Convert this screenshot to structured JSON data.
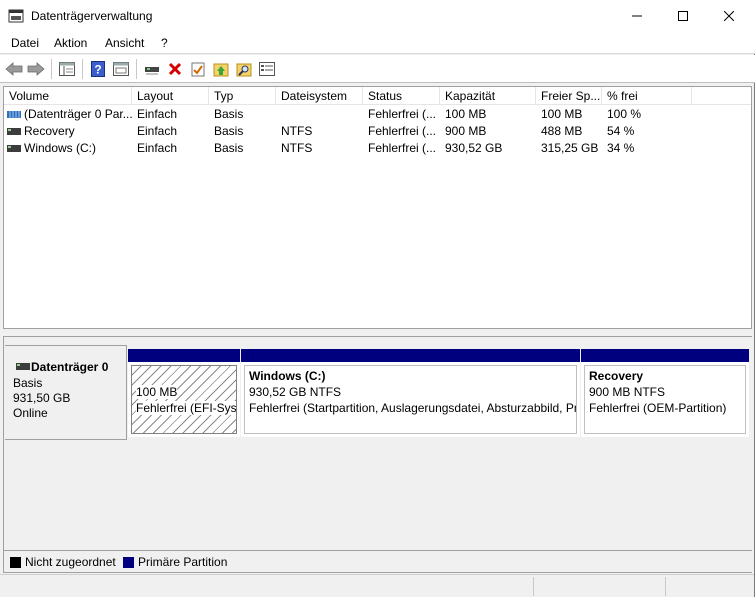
{
  "window": {
    "title": "Datenträgerverwaltung"
  },
  "menu": {
    "items": [
      "Datei",
      "Aktion",
      "Ansicht",
      "?"
    ]
  },
  "toolbar": {
    "icons": [
      "back-arrow-icon",
      "forward-arrow-icon",
      "console-tree-icon",
      "help-icon",
      "properties-view-icon",
      "connect-drive-icon",
      "delete-icon",
      "check-icon",
      "folder-up-icon",
      "folder-search-icon",
      "list-view-icon"
    ]
  },
  "volume_list": {
    "columns": [
      "Volume",
      "Layout",
      "Typ",
      "Dateisystem",
      "Status",
      "Kapazität",
      "Freier Sp...",
      "% frei"
    ],
    "rows": [
      {
        "volume": "(Datenträger 0 Par...",
        "layout": "Einfach",
        "typ": "Basis",
        "dateisystem": "",
        "status": "Fehlerfrei (...",
        "kapazitaet": "100 MB",
        "frei": "100 MB",
        "prozent": "100 %"
      },
      {
        "volume": "Recovery",
        "layout": "Einfach",
        "typ": "Basis",
        "dateisystem": "NTFS",
        "status": "Fehlerfrei (...",
        "kapazitaet": "900 MB",
        "frei": "488 MB",
        "prozent": "54 %"
      },
      {
        "volume": "Windows (C:)",
        "layout": "Einfach",
        "typ": "Basis",
        "dateisystem": "NTFS",
        "status": "Fehlerfrei (...",
        "kapazitaet": "930,52 GB",
        "frei": "315,25 GB",
        "prozent": "34 %"
      }
    ]
  },
  "disk": {
    "name": "Datenträger 0",
    "type": "Basis",
    "size": "931,50 GB",
    "state": "Online",
    "partitions": [
      {
        "title": "",
        "size": "100 MB",
        "status": "Fehlerfrei (EFI-Syst"
      },
      {
        "title": "Windows  (C:)",
        "size": "930,52 GB NTFS",
        "status": "Fehlerfrei (Startpartition, Auslagerungsdatei, Absturzabbild, Pr"
      },
      {
        "title": "Recovery",
        "size": "900 MB NTFS",
        "status": "Fehlerfrei (OEM-Partition)"
      }
    ]
  },
  "legend": {
    "unallocated": "Nicht zugeordnet",
    "primary": "Primäre Partition",
    "unallocated_color": "#000000",
    "primary_color": "#00007f"
  }
}
